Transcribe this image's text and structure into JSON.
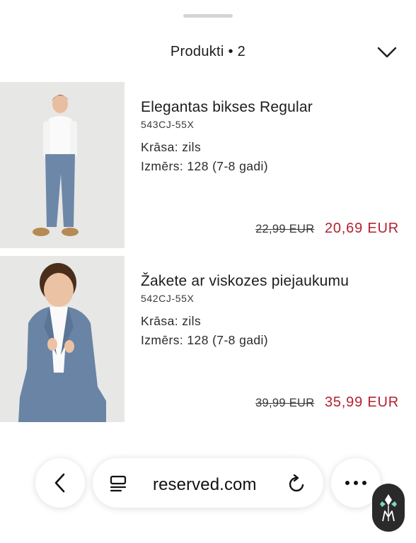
{
  "header": {
    "title": "Produkti • 2"
  },
  "products": [
    {
      "name": "Elegantas bikses Regular",
      "code": "543CJ-55X",
      "color": "Krāsa: zils",
      "size": "Izmērs: 128 (7-8 gadi)",
      "old_price": "22,99 EUR",
      "new_price": "20,69 EUR"
    },
    {
      "name": "Žakete ar viskozes piejaukumu",
      "code": "542CJ-55X",
      "color": "Krāsa: zils",
      "size": "Izmērs: 128 (7-8 gadi)",
      "old_price": "39,99 EUR",
      "new_price": "35,99 EUR"
    }
  ],
  "browser": {
    "url": "reserved.com"
  },
  "colors": {
    "sale_price": "#b3212f",
    "text": "#1c1c1c"
  },
  "icons": [
    "chevron-down-icon",
    "back-arrow-icon",
    "reader-mode-icon",
    "reload-icon",
    "more-icon",
    "app-badge-icon"
  ]
}
